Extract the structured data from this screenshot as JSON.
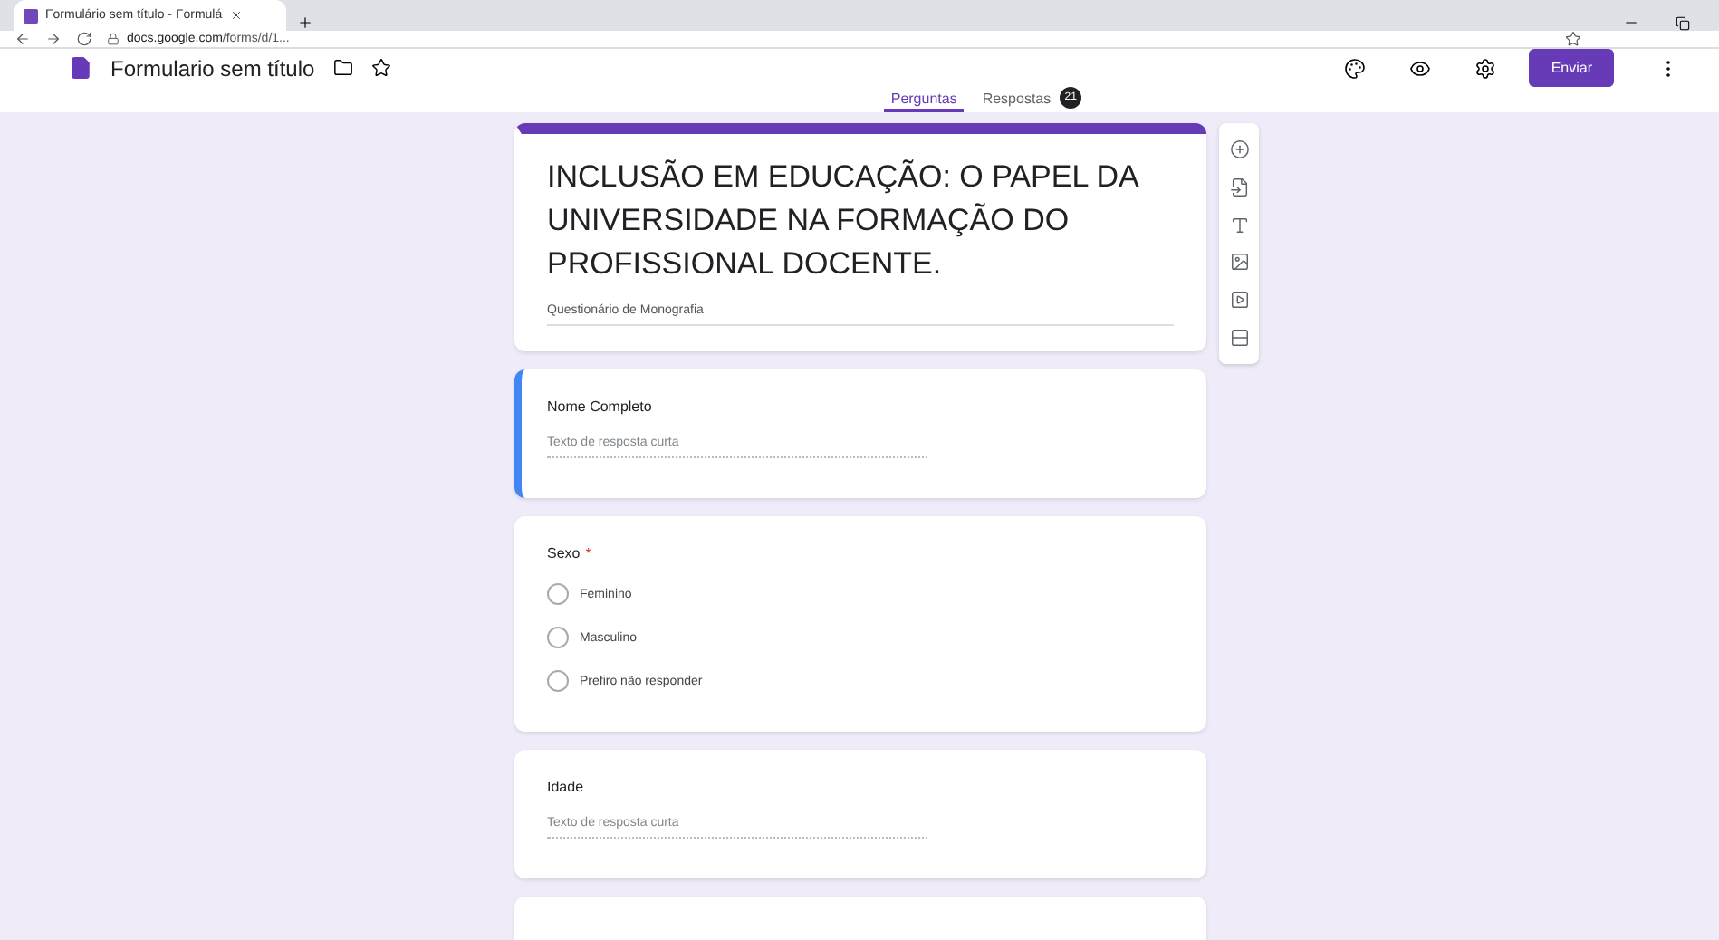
{
  "browser": {
    "tab_title": "Formulário sem título - Formulá",
    "url_host": "docs.google.com",
    "url_path": "/forms/d/1..."
  },
  "header": {
    "title": "Formulario sem título",
    "send_button": "Enviar"
  },
  "tabs": [
    {
      "label": "Perguntas",
      "selected": true
    },
    {
      "label": "Respostas",
      "selected": false,
      "badge": "21"
    }
  ],
  "form": {
    "title": "INCLUSÃO EM EDUCAÇÃO: O PAPEL DA UNIVERSIDADE NA FORMAÇÃO DO PROFISSIONAL DOCENTE.",
    "description": "Questionário de Monografia"
  },
  "questions": [
    {
      "kind": "text",
      "title": "Nome Completo",
      "selected": true,
      "placeholder": "Texto de resposta curta"
    },
    {
      "kind": "radio",
      "title": "Sexo",
      "required_mark": "*",
      "selected": false,
      "options": [
        "Feminino",
        "Masculino",
        "Prefiro não responder"
      ]
    },
    {
      "kind": "text",
      "title": "Idade",
      "selected": false,
      "placeholder": "Texto de resposta curta"
    },
    {
      "kind": "empty",
      "selected": false
    }
  ]
}
